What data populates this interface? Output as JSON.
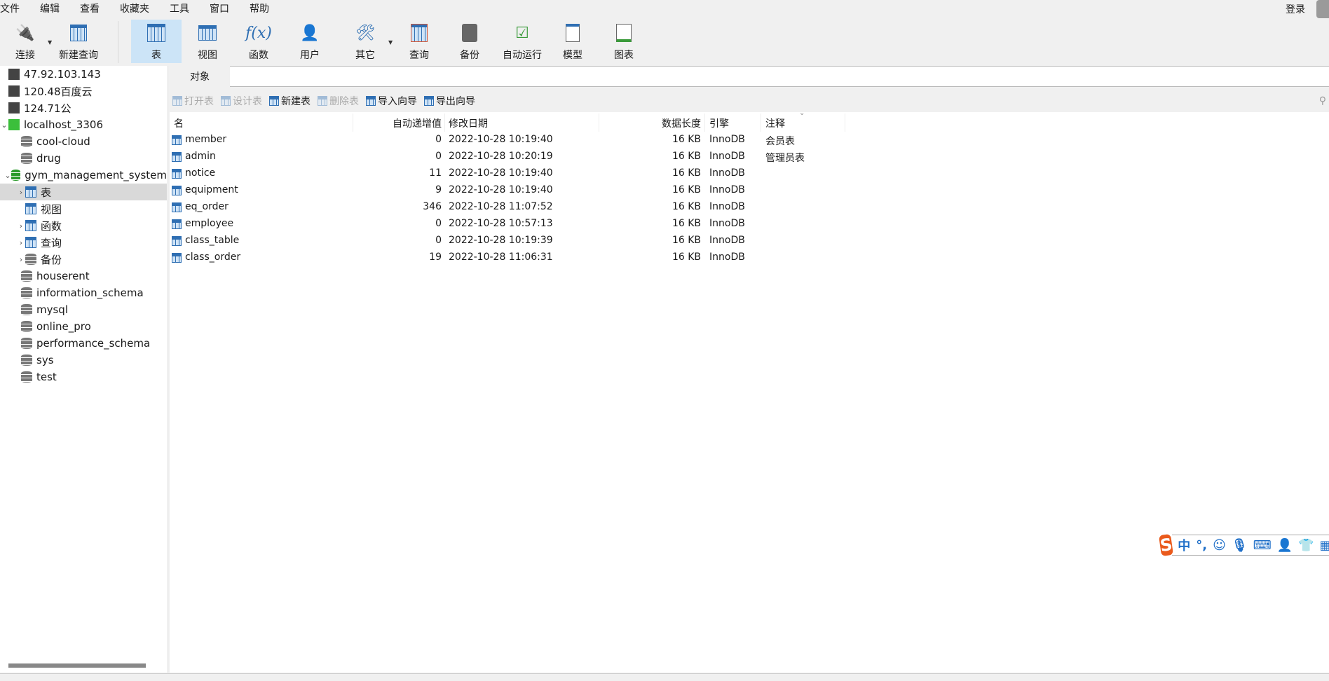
{
  "menu": [
    "文件",
    "编辑",
    "查看",
    "收藏夹",
    "工具",
    "窗口",
    "帮助"
  ],
  "login": "登录",
  "toolbar": {
    "connect": "连接",
    "new_query": "新建查询",
    "table": "表",
    "view": "视图",
    "function": "函数",
    "user": "用户",
    "other": "其它",
    "query": "查询",
    "backup": "备份",
    "automation": "自动运行",
    "model": "模型",
    "chart": "图表"
  },
  "sidebar": {
    "connections": [
      "47.92.103.143",
      "120.48百度云",
      "124.71公"
    ],
    "localhost": "localhost_3306",
    "databases_before": [
      "cool-cloud",
      "drug"
    ],
    "open_db": "gym_management_system",
    "children": [
      "表",
      "视图",
      "函数",
      "查询",
      "备份"
    ],
    "databases_after": [
      "houserent",
      "information_schema",
      "mysql",
      "online_pro",
      "performance_schema",
      "sys",
      "test"
    ]
  },
  "tab": "对象",
  "objbar": {
    "open": "打开表",
    "design": "设计表",
    "new": "新建表",
    "delete": "删除表",
    "import": "导入向导",
    "export": "导出向导"
  },
  "columns": {
    "name": "名",
    "auto_inc": "自动递增值",
    "modified": "修改日期",
    "data_length": "数据长度",
    "engine": "引擎",
    "comment": "注释"
  },
  "rows": [
    {
      "name": "member",
      "auto_inc": "0",
      "modified": "2022-10-28 10:19:40",
      "size": "16 KB",
      "engine": "InnoDB",
      "comment": "会员表"
    },
    {
      "name": "admin",
      "auto_inc": "0",
      "modified": "2022-10-28 10:20:19",
      "size": "16 KB",
      "engine": "InnoDB",
      "comment": "管理员表"
    },
    {
      "name": "notice",
      "auto_inc": "11",
      "modified": "2022-10-28 10:19:40",
      "size": "16 KB",
      "engine": "InnoDB",
      "comment": ""
    },
    {
      "name": "equipment",
      "auto_inc": "9",
      "modified": "2022-10-28 10:19:40",
      "size": "16 KB",
      "engine": "InnoDB",
      "comment": ""
    },
    {
      "name": "eq_order",
      "auto_inc": "346",
      "modified": "2022-10-28 11:07:52",
      "size": "16 KB",
      "engine": "InnoDB",
      "comment": ""
    },
    {
      "name": "employee",
      "auto_inc": "0",
      "modified": "2022-10-28 10:57:13",
      "size": "16 KB",
      "engine": "InnoDB",
      "comment": ""
    },
    {
      "name": "class_table",
      "auto_inc": "0",
      "modified": "2022-10-28 10:19:39",
      "size": "16 KB",
      "engine": "InnoDB",
      "comment": ""
    },
    {
      "name": "class_order",
      "auto_inc": "19",
      "modified": "2022-10-28 11:06:31",
      "size": "16 KB",
      "engine": "InnoDB",
      "comment": ""
    }
  ],
  "ime": {
    "logo": "S",
    "mode": "中",
    "punct": "°,"
  }
}
